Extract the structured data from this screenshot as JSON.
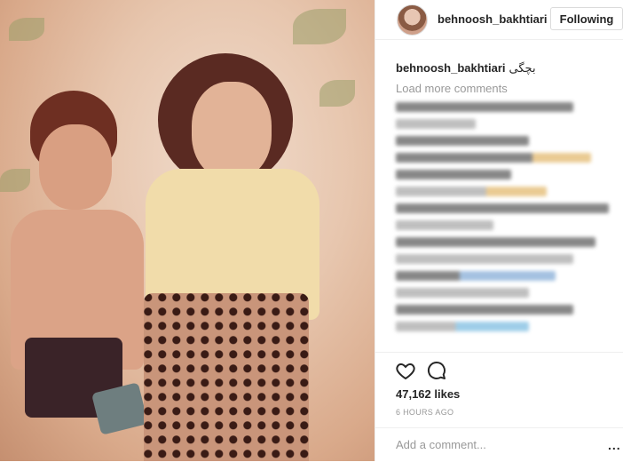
{
  "post": {
    "username": "behnoosh_bakhtiari",
    "follow_label": "Following",
    "caption_user": "behnoosh_bakhtiari",
    "caption_text": "بچگی",
    "load_more": "Load more comments",
    "likes": "47,162 likes",
    "time": "6 HOURS AGO",
    "add_comment_placeholder": "Add a comment...",
    "more_label": "..."
  },
  "icons": [
    "heart-icon",
    "comment-icon",
    "more-options-icon"
  ],
  "colors": {
    "text": "#262626",
    "muted": "#999999",
    "border": "#dbdbdb"
  }
}
